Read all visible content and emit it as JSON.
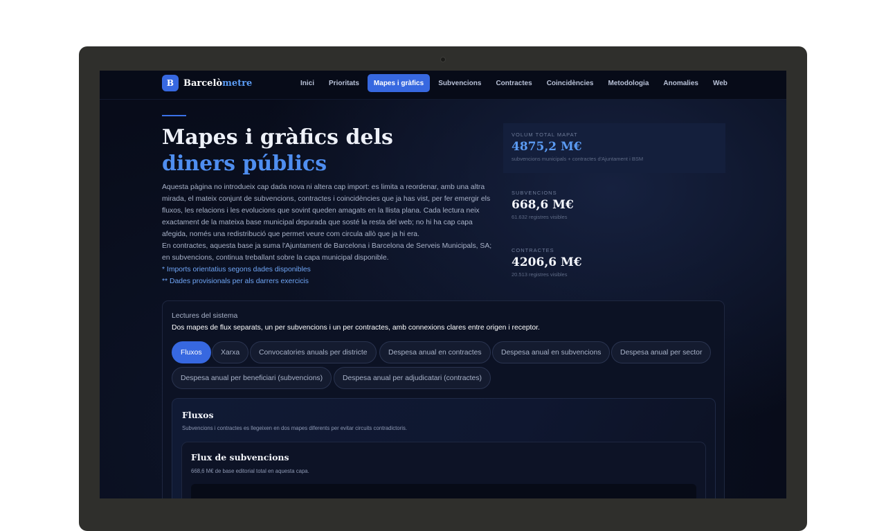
{
  "brand": {
    "logo_letter": "B",
    "name_part1": "Barcelò",
    "name_part2": "metre"
  },
  "nav": {
    "items": [
      {
        "label": "Inici",
        "active": false
      },
      {
        "label": "Prioritats",
        "active": false
      },
      {
        "label": "Mapes i gràfics",
        "active": true
      },
      {
        "label": "Subvencions",
        "active": false
      },
      {
        "label": "Contractes",
        "active": false
      },
      {
        "label": "Coincidències",
        "active": false
      },
      {
        "label": "Metodologia",
        "active": false
      },
      {
        "label": "Anomalies",
        "active": false
      },
      {
        "label": "Web",
        "active": false
      }
    ]
  },
  "hero": {
    "title_main": "Mapes i gràfics dels ",
    "title_accent": "diners públics",
    "paragraph1": "Aquesta pàgina no introdueix cap dada nova ni altera cap import: es limita a reordenar, amb una altra mirada, el mateix conjunt de subvencions, contractes i coincidències que ja has vist, per fer emergir els fluxos, les relacions i les evolucions que sovint queden amagats en la llista plana. Cada lectura neix exactament de la mateixa base municipal depurada que sosté la resta del web; no hi ha cap capa afegida, només una redistribució que permet veure com circula allò que ja hi era.",
    "paragraph2": "En contractes, aquesta base ja suma l'Ajuntament de Barcelona i Barcelona de Serveis Municipals, SA; en subvencions, continua treballant sobre la capa municipal disponible.",
    "note1": "* Imports orientatius segons dades disponibles",
    "note2": "** Dades provisionals per als darrers exercicis"
  },
  "stats": {
    "total": {
      "label": "VOLUM TOTAL MAPAT",
      "value": "4875,2 M€",
      "sub": "subvencions municipals + contractes d'Ajuntament i BSM"
    },
    "subvencions": {
      "label": "SUBVENCIONS",
      "value": "668,6 M€",
      "sub": "61.632 registres visibles"
    },
    "contractes": {
      "label": "CONTRACTES",
      "value": "4206,6 M€",
      "sub": "20.513 registres visibles"
    }
  },
  "panel": {
    "kicker": "Lectures del sistema",
    "description": "Dos mapes de flux separats, un per subvencions i un per contractes, amb connexions clares entre origen i receptor.",
    "tabs": [
      {
        "label": "Fluxos",
        "active": true
      },
      {
        "label": "Xarxa",
        "active": false
      },
      {
        "label": "Convocatories anuals per districte",
        "active": false
      },
      {
        "label": "Despesa anual en contractes",
        "active": false
      },
      {
        "label": "Despesa anual en subvencions",
        "active": false
      },
      {
        "label": "Despesa anual per sector",
        "active": false
      },
      {
        "label": "Despesa anual per beneficiari (subvencions)",
        "active": false
      },
      {
        "label": "Despesa anual per adjudicatari (contractes)",
        "active": false
      }
    ],
    "section": {
      "title": "Fluxos",
      "description": "Subvencions i contractes es llegeixen en dos mapes diferents per evitar circuits contradictoris.",
      "card": {
        "title": "Flux de subvencions",
        "description": "668,6 M€ de base editorial total en aquesta capa."
      }
    }
  },
  "colors": {
    "accent": "#3768e0",
    "accent_text": "#4f8ef0",
    "background": "#080c1a",
    "laptop_frame": "#2f2f2c"
  }
}
